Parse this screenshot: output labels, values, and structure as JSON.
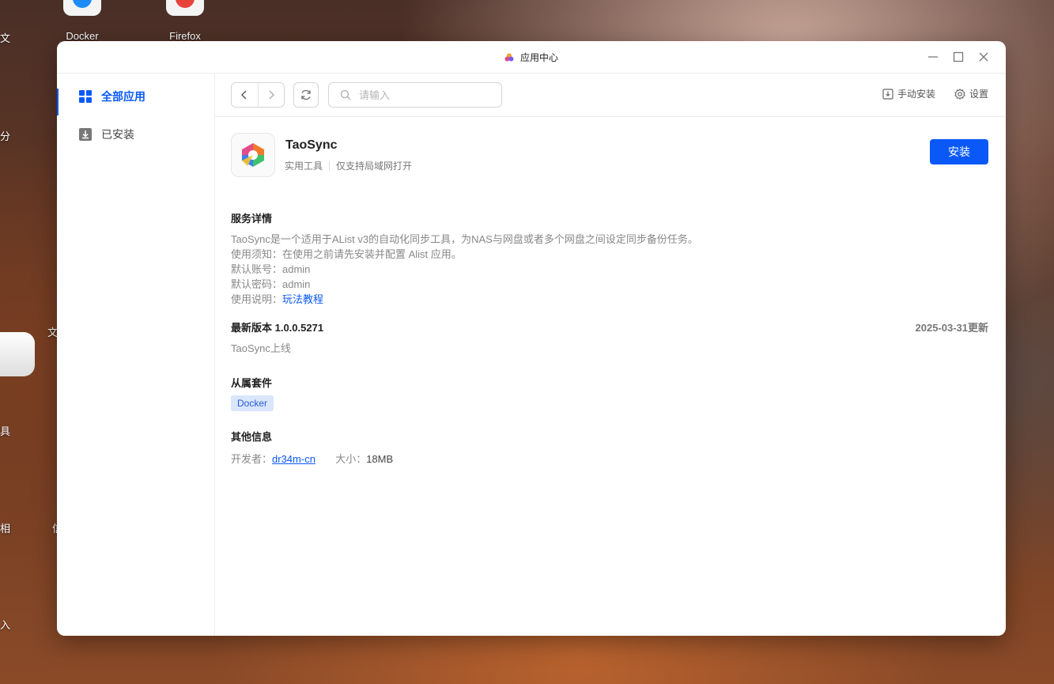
{
  "desktop": {
    "icons": [
      {
        "label": "Docker",
        "color": "#1d8cf8"
      },
      {
        "label": "Firefox",
        "color": "#e8433b"
      }
    ],
    "edge_fragments": [
      "文",
      "分",
      "文",
      "具",
      "相",
      "信",
      "入"
    ]
  },
  "window": {
    "title": "应用中心",
    "controls": [
      "minimize-icon",
      "maximize-icon",
      "close-icon"
    ]
  },
  "sidebar": {
    "items": [
      {
        "label": "全部应用",
        "icon": "grid-icon",
        "active": true
      },
      {
        "label": "已安装",
        "icon": "download-icon",
        "active": false
      }
    ]
  },
  "toolbar": {
    "search_placeholder": "请输入",
    "manual_install_label": "手动安装",
    "settings_label": "设置"
  },
  "app": {
    "name": "TaoSync",
    "category": "实用工具",
    "network_note": "仅支持局域网打开",
    "install_label": "安装",
    "details_title": "服务详情",
    "details": {
      "line1": "TaoSync是一个适用于AList v3的自动化同步工具，为NAS与网盘或者多个网盘之间设定同步备份任务。",
      "line2": "使用须知：在使用之前请先安装并配置 Alist 应用。",
      "line3": "默认账号：admin",
      "line4": "默认密码：admin",
      "line5_prefix": "使用说明：",
      "line5_link": "玩法教程"
    },
    "version_title": "最新版本 1.0.0.5271",
    "version_date": "2025-03-31更新",
    "version_note": "TaoSync上线",
    "suite_title": "从属套件",
    "suite_tag": "Docker",
    "other_title": "其他信息",
    "developer_label": "开发者：",
    "developer_name": "dr34m-cn",
    "size_label": "大小：",
    "size_value": "18MB"
  },
  "colors": {
    "accent": "#0a59f7",
    "tag_bg": "#d9e6fc"
  }
}
